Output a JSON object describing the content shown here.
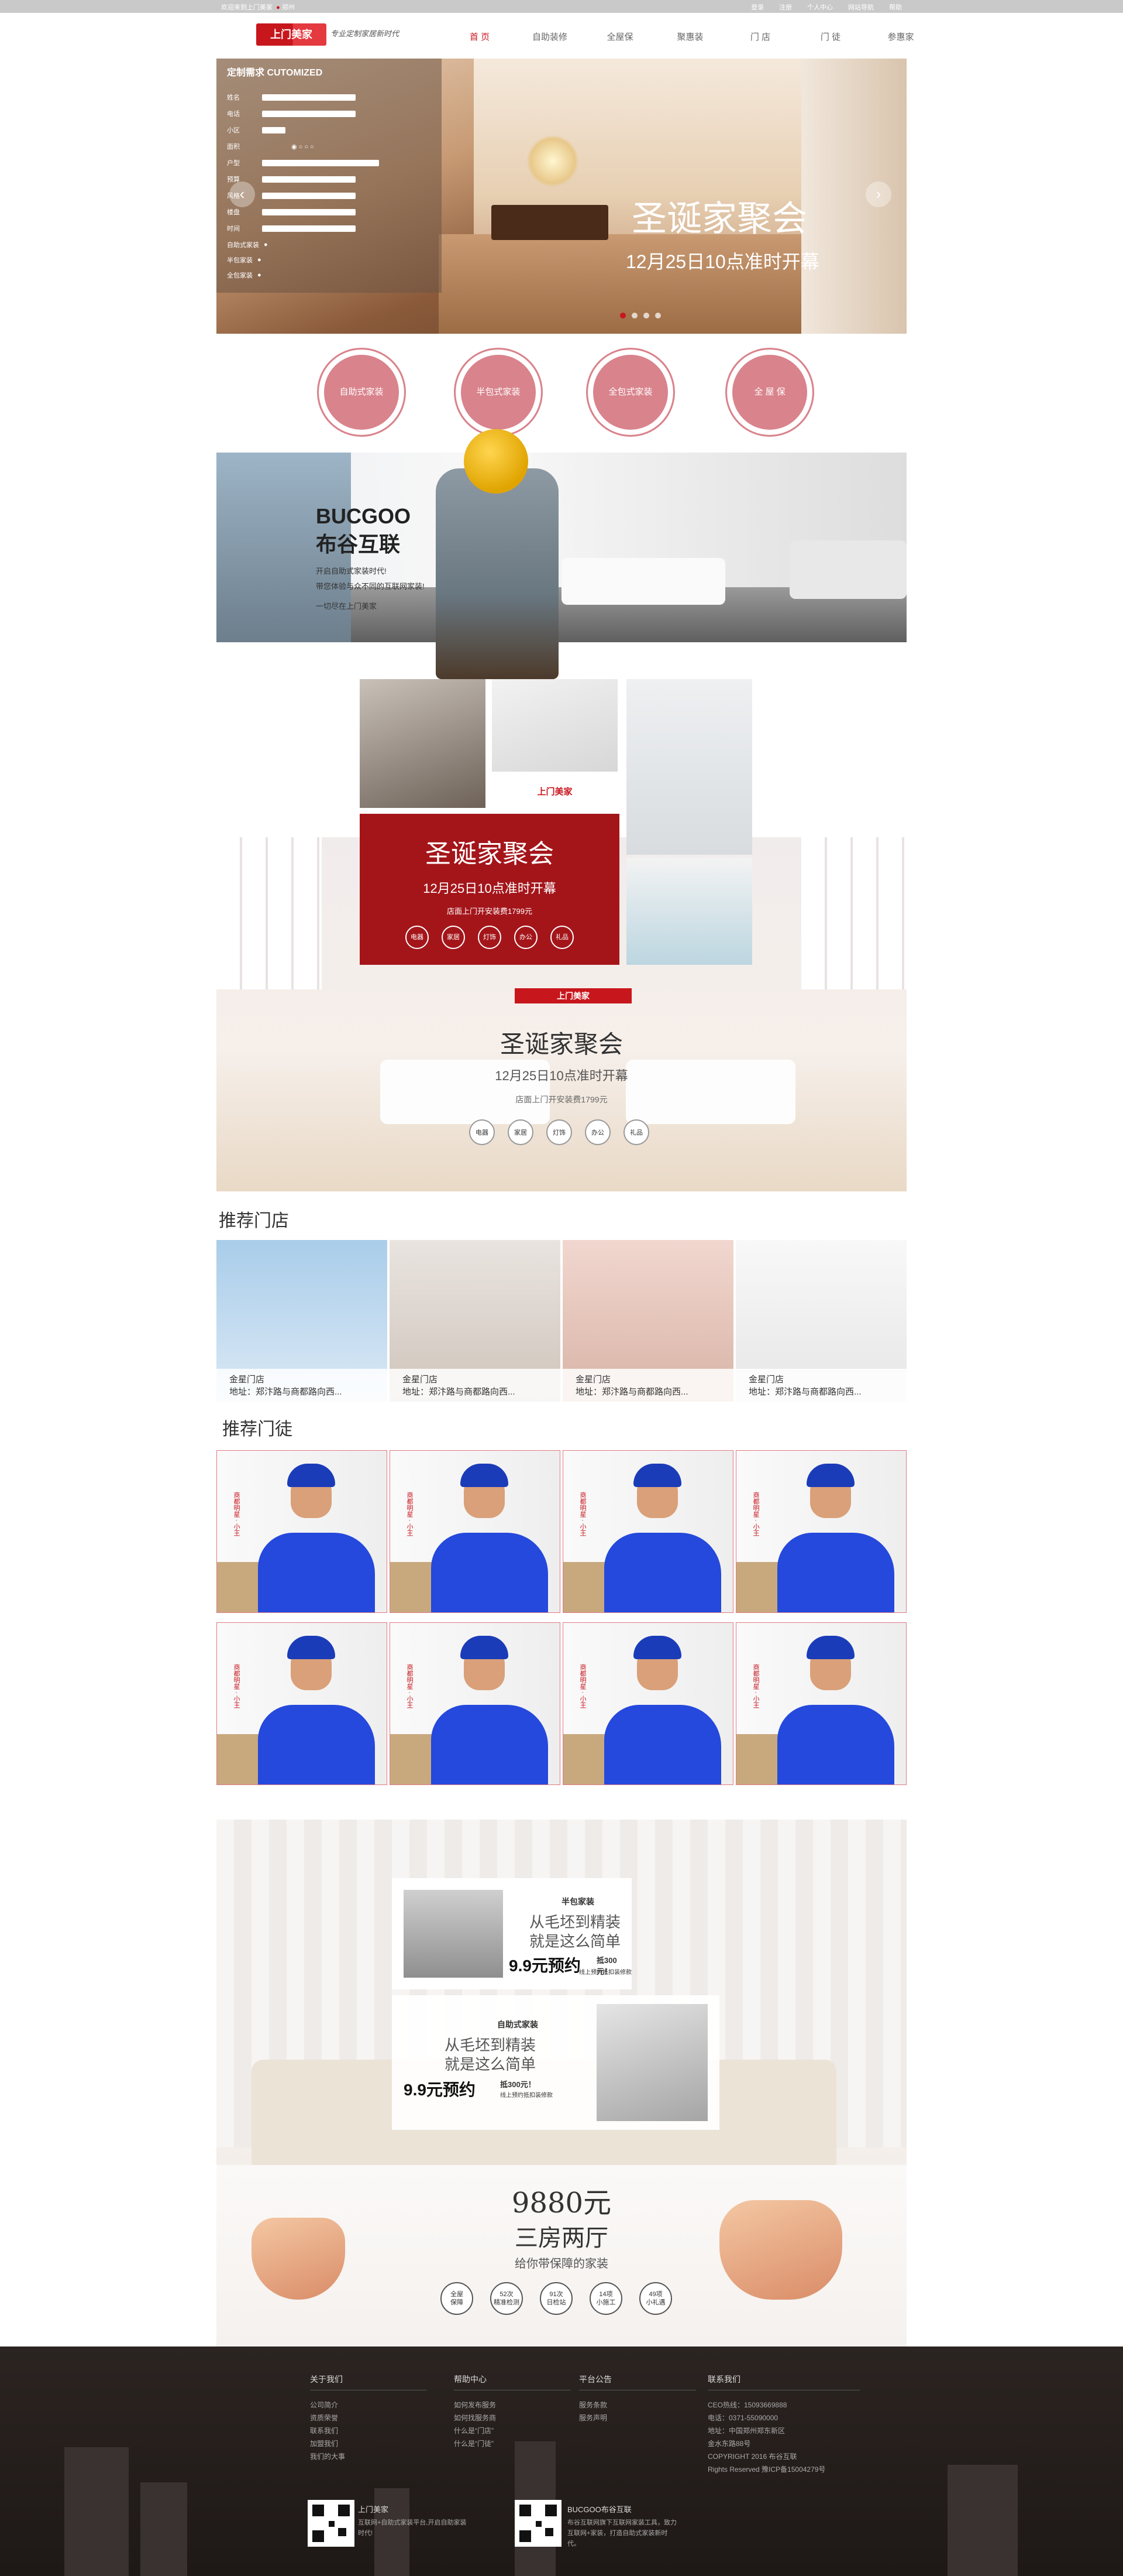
{
  "topbar": {
    "left_text": "欢迎来到上门美家",
    "city": "郑州",
    "links": [
      "登录",
      "注册",
      "个人中心",
      "网站导航",
      "帮助"
    ]
  },
  "header": {
    "logo": "上门美家",
    "logo_sub": "www.shangmeijia.cn",
    "slogan": "专业定制家居新时代",
    "nav": [
      "首 页",
      "自助装修",
      "全屋保",
      "聚惠装",
      "门 店",
      "门 徒",
      "参惠家"
    ]
  },
  "banner": {
    "form_title": "定制需求 CUTOMIZED",
    "form_fields": [
      "姓名",
      "电话",
      "小区",
      "面积",
      "户型",
      "预算",
      "风格",
      "楼盘",
      "时间"
    ],
    "form_options": [
      "自助式家装",
      "半包家装",
      "全包家装"
    ],
    "title": "圣诞家聚会",
    "subtitle": "12月25日10点准时开幕",
    "colors": {
      "accent": "#c8161d"
    }
  },
  "services": [
    "自助式家装",
    "半包式家装",
    "全包式家装",
    "全 屋 保"
  ],
  "bucgoo": {
    "brand": "BUCGOO",
    "name": "布谷互联",
    "lines": [
      "开启自助式家装时代!",
      "带您体验与众不同的互联网家装!",
      "一切尽在上门美家"
    ]
  },
  "xmas": {
    "title": "圣诞家聚会",
    "subtitle": "12月25日10点准时开幕",
    "note": "店面上门开安装费1799元",
    "tags": [
      "电器",
      "家居",
      "灯饰",
      "办公",
      "礼品"
    ]
  },
  "living": {
    "logo": "上门美家",
    "title": "圣诞家聚会",
    "subtitle": "12月25日10点准时开幕",
    "note": "店面上门开安装费1799元",
    "tags": [
      "电器",
      "家居",
      "灯饰",
      "办公",
      "礼品"
    ]
  },
  "stores": {
    "title": "推荐门店",
    "items": [
      {
        "name": "金星门店",
        "addr": "地址：郑汴路与商都路向西..."
      },
      {
        "name": "金星门店",
        "addr": "地址：郑汴路与商都路向西..."
      },
      {
        "name": "金星门店",
        "addr": "地址：郑汴路与商都路向西..."
      },
      {
        "name": "金星门店",
        "addr": "地址：郑汴路与商都路向西..."
      }
    ]
  },
  "workers": {
    "title": "推荐门徒",
    "label": "商都明星 · 小王",
    "count": 8
  },
  "promo": {
    "half_title": "半包家装",
    "half_line1": "从毛坯到精装",
    "half_line2": "就是这么简单",
    "price1": "9.9元预约",
    "save1": "抵300元！",
    "save1b": "线上预约抵扣装修款",
    "self_title": "自助式家装",
    "self_line1": "从毛坯到精装",
    "self_line2": "就是这么简单",
    "price2": "9.9元预约",
    "save2": "抵300元！",
    "save2b": "线上预约抵扣装修款",
    "big_price": "9880元",
    "big_rooms": "三房两厅",
    "big_desc": "给你带保障的家装",
    "pills": [
      [
        "全屋",
        "保障"
      ],
      [
        "52次",
        "精准检测"
      ],
      [
        "91次",
        "日检站"
      ],
      [
        "14项",
        "小施工"
      ],
      [
        "49项",
        "小礼遇"
      ]
    ]
  },
  "footer": {
    "cols": [
      {
        "title": "关于我们",
        "items": [
          "公司简介",
          "资质荣誉",
          "联系我们",
          "加盟我们",
          "我们的大事"
        ]
      },
      {
        "title": "帮助中心",
        "items": [
          "如何发布服务",
          "如何找服务商",
          "什么是“门店”",
          "什么是“门徒”"
        ]
      },
      {
        "title": "平台公告",
        "items": [
          "服务条款",
          "服务声明"
        ]
      },
      {
        "title": "联系我们",
        "items": [
          "CEO热线：15093669888",
          "电话：0371-55090000",
          "地址：中国郑州郑东新区",
          "金水东路88号",
          "COPYRIGHT 2016 布谷互联",
          "Rights Reserved 豫ICP备15004279号"
        ]
      }
    ],
    "qr1_title": "上门美家",
    "qr1_text": "互联网+自助式家装平台,开启自助家装时代!",
    "qr2_title": "BUCGOO布谷互联",
    "qr2_text": "布谷互联网旗下互联网家装工具，致力互联网+家装，打造自助式家装新时代。"
  }
}
